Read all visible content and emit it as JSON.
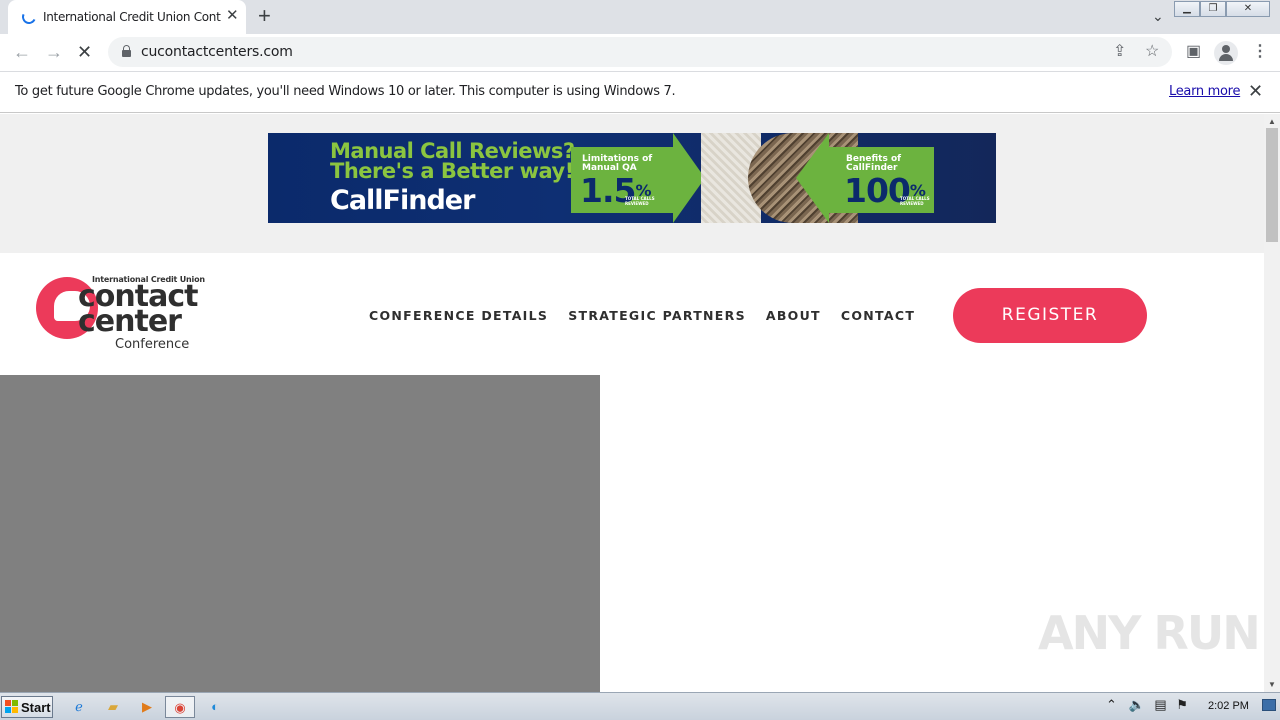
{
  "browser": {
    "tab_title": "International Credit Union Contact C",
    "new_tab_icon": "plus-icon",
    "url": "cucontactcenters.com"
  },
  "infobar": {
    "message": "To get future Google Chrome updates, you'll need Windows 10 or later. This computer is using Windows 7.",
    "learn_more": "Learn more"
  },
  "ad_banner": {
    "headline_1": "Manual Call Reviews?",
    "headline_2": "There's a Better way!",
    "brand": "CallFinder",
    "left_box_label_1": "Limitations of",
    "left_box_label_2": "Manual QA",
    "left_box_value": "1.5",
    "right_box_label_1": "Benefits of",
    "right_box_label_2": "CallFinder",
    "right_box_value": "100",
    "percent_sign": "%",
    "left_fine_1": "TOTAL CALLS",
    "left_fine_2": "REVIEWED",
    "right_fine_1": "TOTAL CALLS",
    "right_fine_2": "REVIEWED",
    "colors": {
      "navy": "#0b2a6b",
      "green": "#6cb33f"
    }
  },
  "site": {
    "logo_top": "International Credit Union",
    "logo_line1": "contact",
    "logo_line2": "center",
    "logo_line3": "Conference",
    "nav": [
      "CONFERENCE DETAILS",
      "STRATEGIC PARTNERS",
      "ABOUT",
      "CONTACT"
    ],
    "register": "REGISTER",
    "accent_color": "#ec3a5a"
  },
  "watermark": "ANY RUN",
  "taskbar": {
    "start": "Start",
    "clock": "2:02 PM",
    "apps": [
      "ie-icon",
      "folder-icon",
      "media-player-icon",
      "chrome-icon",
      "edge-icon"
    ]
  }
}
